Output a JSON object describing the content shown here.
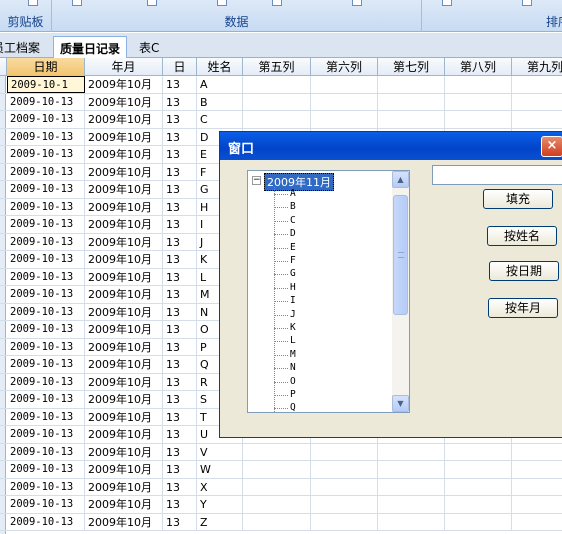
{
  "ribbon": {
    "groups": [
      {
        "label": "剪贴板"
      },
      {
        "label": "数据"
      },
      {
        "label": "排序"
      }
    ]
  },
  "sheet_tabs": [
    {
      "label": "员工档案",
      "active": false
    },
    {
      "label": "质量日记录",
      "active": true
    },
    {
      "label": "表C",
      "active": false
    }
  ],
  "grid": {
    "columns": [
      "日期",
      "年月",
      "日",
      "姓名",
      "第五列",
      "第六列",
      "第七列",
      "第八列",
      "第九列"
    ],
    "rows": [
      {
        "date": "2009-10-1",
        "ym": "2009年10月",
        "day": "13",
        "name": "A"
      },
      {
        "date": "2009-10-13",
        "ym": "2009年10月",
        "day": "13",
        "name": "B"
      },
      {
        "date": "2009-10-13",
        "ym": "2009年10月",
        "day": "13",
        "name": "C"
      },
      {
        "date": "2009-10-13",
        "ym": "2009年10月",
        "day": "13",
        "name": "D"
      },
      {
        "date": "2009-10-13",
        "ym": "2009年10月",
        "day": "13",
        "name": "E"
      },
      {
        "date": "2009-10-13",
        "ym": "2009年10月",
        "day": "13",
        "name": "F"
      },
      {
        "date": "2009-10-13",
        "ym": "2009年10月",
        "day": "13",
        "name": "G"
      },
      {
        "date": "2009-10-13",
        "ym": "2009年10月",
        "day": "13",
        "name": "H"
      },
      {
        "date": "2009-10-13",
        "ym": "2009年10月",
        "day": "13",
        "name": "I"
      },
      {
        "date": "2009-10-13",
        "ym": "2009年10月",
        "day": "13",
        "name": "J"
      },
      {
        "date": "2009-10-13",
        "ym": "2009年10月",
        "day": "13",
        "name": "K"
      },
      {
        "date": "2009-10-13",
        "ym": "2009年10月",
        "day": "13",
        "name": "L"
      },
      {
        "date": "2009-10-13",
        "ym": "2009年10月",
        "day": "13",
        "name": "M"
      },
      {
        "date": "2009-10-13",
        "ym": "2009年10月",
        "day": "13",
        "name": "N"
      },
      {
        "date": "2009-10-13",
        "ym": "2009年10月",
        "day": "13",
        "name": "O"
      },
      {
        "date": "2009-10-13",
        "ym": "2009年10月",
        "day": "13",
        "name": "P"
      },
      {
        "date": "2009-10-13",
        "ym": "2009年10月",
        "day": "13",
        "name": "Q"
      },
      {
        "date": "2009-10-13",
        "ym": "2009年10月",
        "day": "13",
        "name": "R"
      },
      {
        "date": "2009-10-13",
        "ym": "2009年10月",
        "day": "13",
        "name": "S"
      },
      {
        "date": "2009-10-13",
        "ym": "2009年10月",
        "day": "13",
        "name": "T"
      },
      {
        "date": "2009-10-13",
        "ym": "2009年10月",
        "day": "13",
        "name": "U"
      },
      {
        "date": "2009-10-13",
        "ym": "2009年10月",
        "day": "13",
        "name": "V"
      },
      {
        "date": "2009-10-13",
        "ym": "2009年10月",
        "day": "13",
        "name": "W"
      },
      {
        "date": "2009-10-13",
        "ym": "2009年10月",
        "day": "13",
        "name": "X"
      },
      {
        "date": "2009-10-13",
        "ym": "2009年10月",
        "day": "13",
        "name": "Y"
      },
      {
        "date": "2009-10-13",
        "ym": "2009年10月",
        "day": "13",
        "name": "Z"
      }
    ]
  },
  "dialog": {
    "title": "窗口",
    "close_label": "×",
    "textbox_value": "",
    "tree": {
      "root_label": "2009年11月",
      "expander": "−",
      "items": [
        "A",
        "B",
        "C",
        "D",
        "E",
        "F",
        "G",
        "H",
        "I",
        "J",
        "K",
        "L",
        "M",
        "N",
        "O",
        "P",
        "Q"
      ]
    },
    "buttons": {
      "fill": "填充",
      "by_name": "按姓名",
      "by_date": "按日期",
      "by_month": "按年月"
    }
  },
  "colors": {
    "title_bar": "#0a5ee6",
    "selection": "#316ac5",
    "dialog_bg": "#ece9d8"
  }
}
